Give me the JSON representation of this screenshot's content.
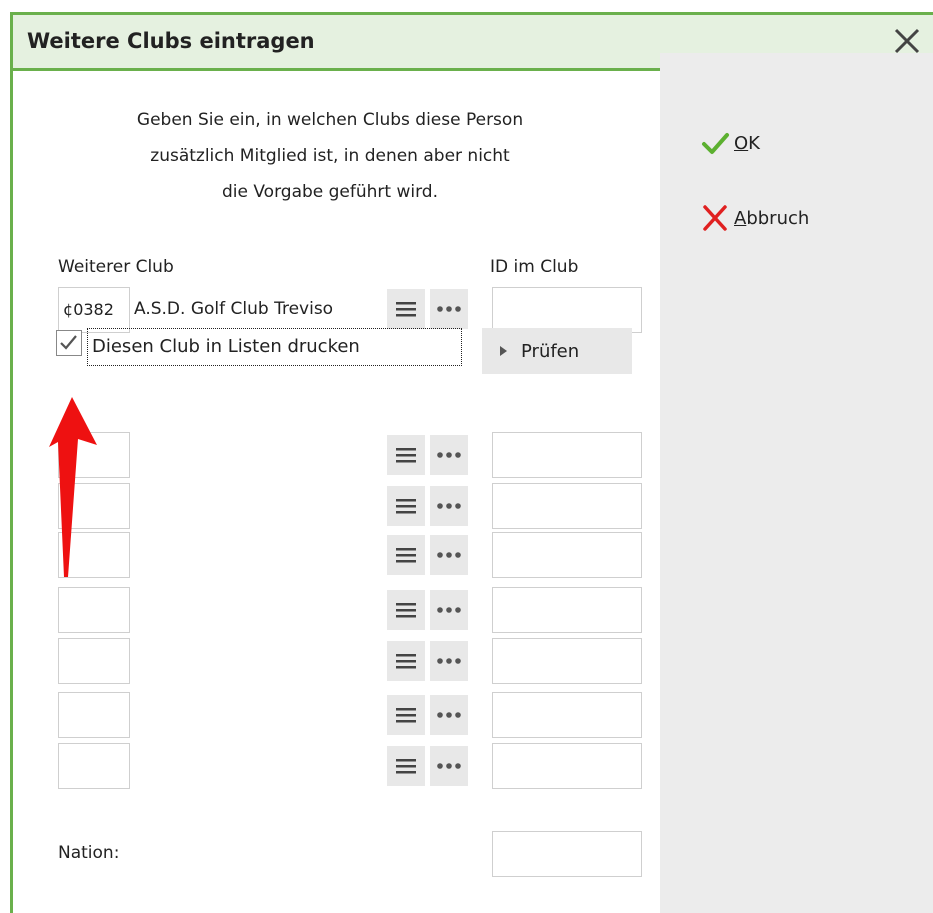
{
  "dialog": {
    "title": "Weitere Clubs eintragen",
    "close_icon": "close-icon"
  },
  "actions": {
    "ok_label": "OK",
    "ok_mnemonic": "O",
    "ok_rest": "K",
    "cancel_label": "Abbruch",
    "cancel_mnemonic": "A",
    "cancel_rest": "bbruch"
  },
  "intro": {
    "line1": "Geben Sie ein, in welchen Clubs diese Person",
    "line2": "zusätzlich Mitglied ist, in denen aber nicht",
    "line3": "die Vorgabe geführt wird."
  },
  "columns": {
    "club": "Weiterer Club",
    "id": "ID im Club"
  },
  "first_club": {
    "number": "0382",
    "number_prefix": "¢",
    "name": "A.S.D. Golf Club Treviso",
    "id": ""
  },
  "print_option": {
    "label": "Diesen Club in Listen drucken",
    "checked": true
  },
  "pruefen_label": "Prüfen",
  "empty_rows": 7,
  "nation_label": "Nation:",
  "nation_value": "",
  "colors": {
    "accent_green": "#6ab04c",
    "title_bg": "#e5f1e0",
    "ok_green": "#5cb030",
    "cancel_red": "#e02020",
    "arrow_red": "#ee1111"
  }
}
